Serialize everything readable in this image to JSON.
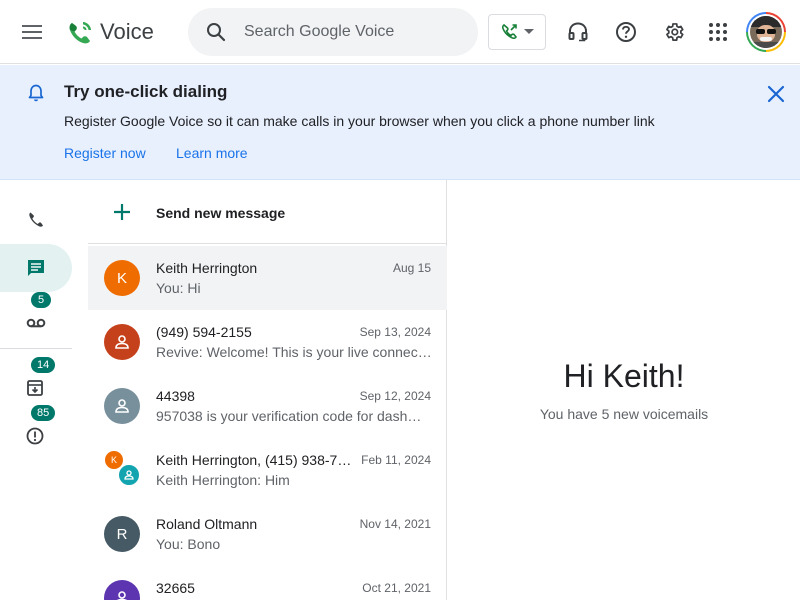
{
  "header": {
    "app_name": "Voice",
    "search_placeholder": "Search Google Voice"
  },
  "banner": {
    "title": "Try one-click dialing",
    "text": "Register Google Voice so it can make calls in your browser when you click a phone number link",
    "register_label": "Register now",
    "learn_label": "Learn more"
  },
  "rail": {
    "voicemail_badge": "5",
    "archive_badge": "14",
    "spam_badge": "85"
  },
  "list": {
    "send_new_label": "Send new message",
    "conversations": [
      {
        "avatar": "K",
        "avatar_color": "#ef6c00",
        "name": "Keith Herrington",
        "date": "Aug 15",
        "preview": "You: Hi"
      },
      {
        "avatar": "",
        "avatar_color": "#c5411b",
        "name": "(949) 594-2155",
        "date": "Sep 13, 2024",
        "preview": "Revive: Welcome! This is your live connec…"
      },
      {
        "avatar": "",
        "avatar_color": "#78909c",
        "name": "44398",
        "date": "Sep 12, 2024",
        "preview": "957038 is your verification code for dash…"
      },
      {
        "avatar": "K",
        "avatar_color": "#ef6c00",
        "name": "Keith Herrington, (415) 938-7…",
        "date": "Feb 11, 2024",
        "preview": "Keith Herrington: Him"
      },
      {
        "avatar": "R",
        "avatar_color": "#455a64",
        "name": "Roland Oltmann",
        "date": "Nov 14, 2021",
        "preview": "You: Bono"
      },
      {
        "avatar": "",
        "avatar_color": "#5e35b1",
        "name": "32665",
        "date": "Oct 21, 2021",
        "preview": ""
      }
    ]
  },
  "main": {
    "greeting": "Hi Keith!",
    "voicemail_text": "You have 5 new voicemails"
  },
  "colors": {
    "accent": "#1a73e8",
    "banner_bg": "#e8f0fe",
    "badge": "#00796b",
    "selected_rail": "#e6f4ea"
  }
}
